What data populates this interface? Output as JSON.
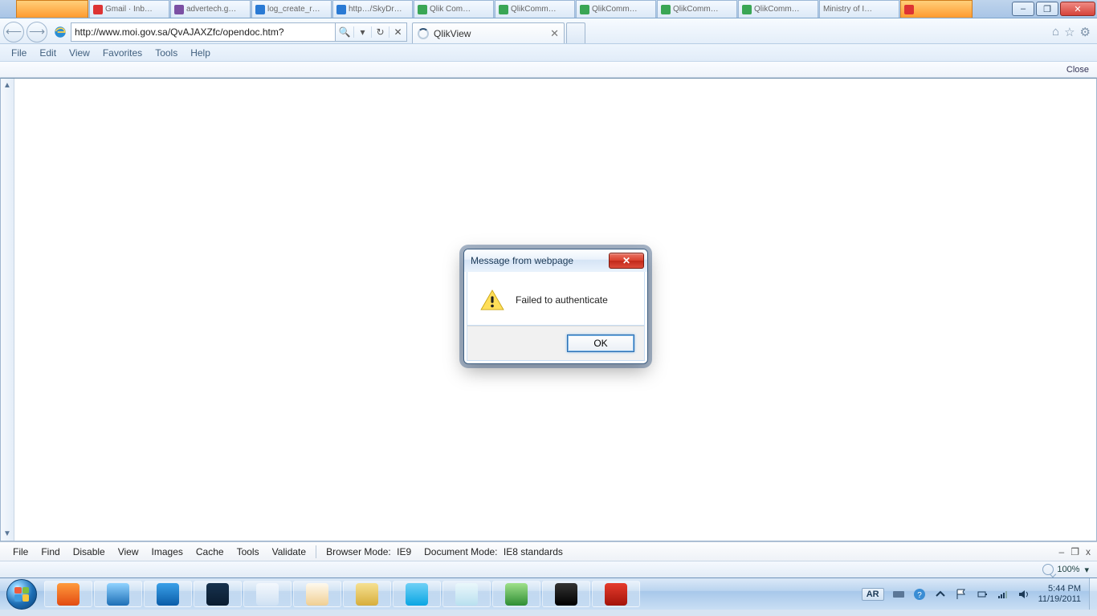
{
  "window_controls": {
    "minimize": "–",
    "maximize": "❐",
    "close": "✕"
  },
  "top_tabs": [
    {
      "label": "",
      "cls": "orange"
    },
    {
      "label": "Gmail · Inb…",
      "ico": "r"
    },
    {
      "label": "advertech.g…",
      "ico": "p"
    },
    {
      "label": "log_create_r…",
      "ico": "b"
    },
    {
      "label": "http…/SkyDr…",
      "ico": "b"
    },
    {
      "label": "Qlik Com…",
      "ico": "g"
    },
    {
      "label": "QlikComm…",
      "ico": "g"
    },
    {
      "label": "QlikComm…",
      "ico": "g"
    },
    {
      "label": "QlikComm…",
      "ico": "g"
    },
    {
      "label": "QlikComm…",
      "ico": "g"
    },
    {
      "label": "Ministry of I…",
      "ico": ""
    },
    {
      "label": "",
      "ico": "r",
      "cls": "orange"
    }
  ],
  "address_bar": {
    "url": "http://www.moi.gov.sa/QvAJAXZfc/opendoc.htm?",
    "search_glyph": "🔍",
    "dropdown_glyph": "▾",
    "refresh_glyph": "↻",
    "stop_glyph": "✕"
  },
  "tabs": {
    "active": {
      "title": "QlikView"
    },
    "close_glyph": "✕"
  },
  "ie_right_tools": {
    "home": "⌂",
    "fav": "☆",
    "gear": "⚙"
  },
  "ie_menu": [
    "File",
    "Edit",
    "View",
    "Favorites",
    "Tools",
    "Help"
  ],
  "page_bar": {
    "close": "Close"
  },
  "dialog": {
    "title": "Message from webpage",
    "message": "Failed to authenticate",
    "ok": "OK",
    "close_glyph": "✕"
  },
  "dev_bar": {
    "items": [
      "File",
      "Find",
      "Disable",
      "View",
      "Images",
      "Cache",
      "Tools",
      "Validate"
    ],
    "browser_mode_label": "Browser Mode:",
    "browser_mode_value": "IE9",
    "doc_mode_label": "Document Mode:",
    "doc_mode_value": "IE8 standards",
    "min": "–",
    "pin": "❐",
    "close": "x"
  },
  "zoom_bar": {
    "value": "100%",
    "dropdown": "▾"
  },
  "tray": {
    "lang": "AR",
    "time": "5:44 PM",
    "date": "11/19/2011"
  },
  "taskbar_apps": [
    {
      "name": "firefox",
      "color": "linear-gradient(#ff9a3c,#e24b12)"
    },
    {
      "name": "ie",
      "color": "linear-gradient(#8fd2ff,#1e6fb6)"
    },
    {
      "name": "vm",
      "color": "linear-gradient(#3aa0e8,#0a5ca8)"
    },
    {
      "name": "photoshop",
      "color": "linear-gradient(#17324e,#0a1c30)"
    },
    {
      "name": "device",
      "color": "linear-gradient(#f4f8fd,#cfe1f3)"
    },
    {
      "name": "paint",
      "color": "linear-gradient(#fef9ee,#f0cf93)"
    },
    {
      "name": "explorer",
      "color": "linear-gradient(#f6e192,#d7ae3c)"
    },
    {
      "name": "skype",
      "color": "linear-gradient(#6fd0f6,#0aa6e3)"
    },
    {
      "name": "notepad",
      "color": "linear-gradient(#eaf7fb,#b9e0ef)"
    },
    {
      "name": "excel",
      "color": "linear-gradient(#9fe08a,#2f8e34)"
    },
    {
      "name": "cmd",
      "color": "linear-gradient(#333,#000)"
    },
    {
      "name": "adobe",
      "color": "linear-gradient(#e53b2c,#a3140a)"
    }
  ]
}
